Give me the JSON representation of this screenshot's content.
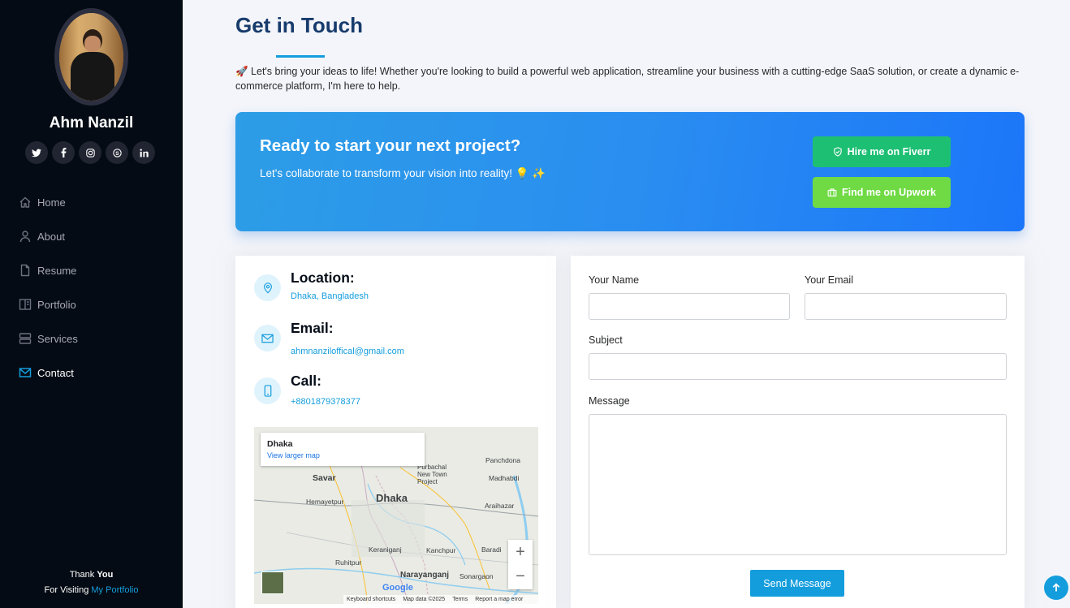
{
  "sidebar": {
    "name": "Ahm Nanzil",
    "socials": [
      {
        "icon": "twitter-icon",
        "glyph": "t"
      },
      {
        "icon": "facebook-icon",
        "glyph": "f"
      },
      {
        "icon": "instagram-icon",
        "glyph": "◎"
      },
      {
        "icon": "skype-icon",
        "glyph": "S"
      },
      {
        "icon": "linkedin-icon",
        "glyph": "in"
      }
    ],
    "nav": [
      {
        "label": "Home",
        "icon": "house-icon",
        "active": false
      },
      {
        "label": "About",
        "icon": "person-icon",
        "active": false
      },
      {
        "label": "Resume",
        "icon": "file-icon",
        "active": false
      },
      {
        "label": "Portfolio",
        "icon": "book-icon",
        "active": false
      },
      {
        "label": "Services",
        "icon": "server-icon",
        "active": false
      },
      {
        "label": "Contact",
        "icon": "envelope-icon",
        "active": true
      }
    ],
    "footer": {
      "line1_prefix": "Thank ",
      "line1_bold": "You",
      "line2_prefix": "For Visiting ",
      "line2_link": "My Portfolio"
    }
  },
  "main": {
    "title": "Get in Touch",
    "intro": "🚀 Let's bring your ideas to life! Whether you're looking to build a powerful web application, streamline your business with a cutting-edge SaaS solution, or create a dynamic e-commerce platform, I'm here to help.",
    "cta": {
      "title": "Ready to start your next project?",
      "subtitle": "Let's collaborate to transform your vision into reality! 💡 ✨",
      "fiverr_label": "Hire me on Fiverr",
      "upwork_label": "Find me on Upwork"
    },
    "info": {
      "location_label": "Location:",
      "location_value": "Dhaka, Bangladesh",
      "email_label": "Email:",
      "email_value": "ahmnanziloffical@gmail.com",
      "call_label": "Call:",
      "call_value": "+8801879378377"
    },
    "map": {
      "place": "Dhaka",
      "link": "View larger map",
      "labels": [
        "Savar",
        "Dhaka",
        "Hemayetpur",
        "Purbachal New Town Project",
        "Madhabdi",
        "Araihazar",
        "Panchdona",
        "Narayanganj",
        "Keraniganj",
        "Kanchpur",
        "Ruhitpur",
        "Baradi",
        "Sonargaon"
      ],
      "footer": [
        "Keyboard shortcuts",
        "Map data ©2025",
        "Terms",
        "Report a map error"
      ],
      "google": "Google"
    },
    "form": {
      "name_label": "Your Name",
      "email_label": "Your Email",
      "subject_label": "Subject",
      "message_label": "Message",
      "name_value": "",
      "email_value": "",
      "subject_value": "",
      "message_value": "",
      "submit_label": "Send Message"
    }
  },
  "colors": {
    "accent": "#149ddd",
    "sidebar_bg": "#040b14",
    "title": "#173b6c",
    "fiverr": "#1dbf73",
    "upwork": "#6fda44"
  }
}
